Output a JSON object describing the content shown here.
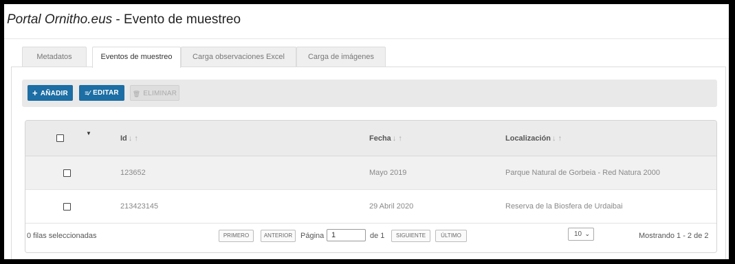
{
  "title": {
    "brand": "Portal Ornitho.eus",
    "suffix": " - Evento de muestreo"
  },
  "tabs": [
    {
      "label": "Metadatos",
      "active": false
    },
    {
      "label": "Eventos de muestreo",
      "active": true
    },
    {
      "label": "Carga observaciones Excel",
      "active": false
    },
    {
      "label": "Carga de imágenes",
      "active": false
    }
  ],
  "toolbar": {
    "add_label": "AÑADIR",
    "add_icon": "+",
    "edit_label": "EDITAR",
    "edit_icon": "≡⁄",
    "delete_label": "ELIMINAR",
    "delete_icon": "🗑"
  },
  "grid": {
    "header_caret": "▼",
    "columns": [
      {
        "label": "Id",
        "sort": "↓ ↑"
      },
      {
        "label": "Fecha",
        "sort": "↓ ↑"
      },
      {
        "label": "Localización",
        "sort": "↓ ↑"
      }
    ],
    "rows": [
      {
        "id": "123652",
        "fecha": "Mayo 2019",
        "localizacion": "Parque Natural de Gorbeia - Red Natura 2000",
        "checked": false
      },
      {
        "id": "213423145",
        "fecha": "29 Abril 2020",
        "localizacion": "Reserva de la Biosfera de Urdaibai",
        "checked": false
      }
    ]
  },
  "footer": {
    "selected_text": "0 filas seleccionadas",
    "first_label": "PRIMERO",
    "prev_label": "ANTERIOR",
    "page_label": "Página",
    "page_value": "1",
    "of_label": "de 1",
    "next_label": "SIGUIENTE",
    "last_label": "ÚLTIMO",
    "page_size": "10",
    "page_size_chevron": "⌄",
    "showing_text": "Mostrando 1 - 2 de 2"
  },
  "colors": {
    "primary": "#1c6ea4",
    "header_bg": "#ebebeb",
    "toolbar_bg": "#e9e9e9"
  }
}
